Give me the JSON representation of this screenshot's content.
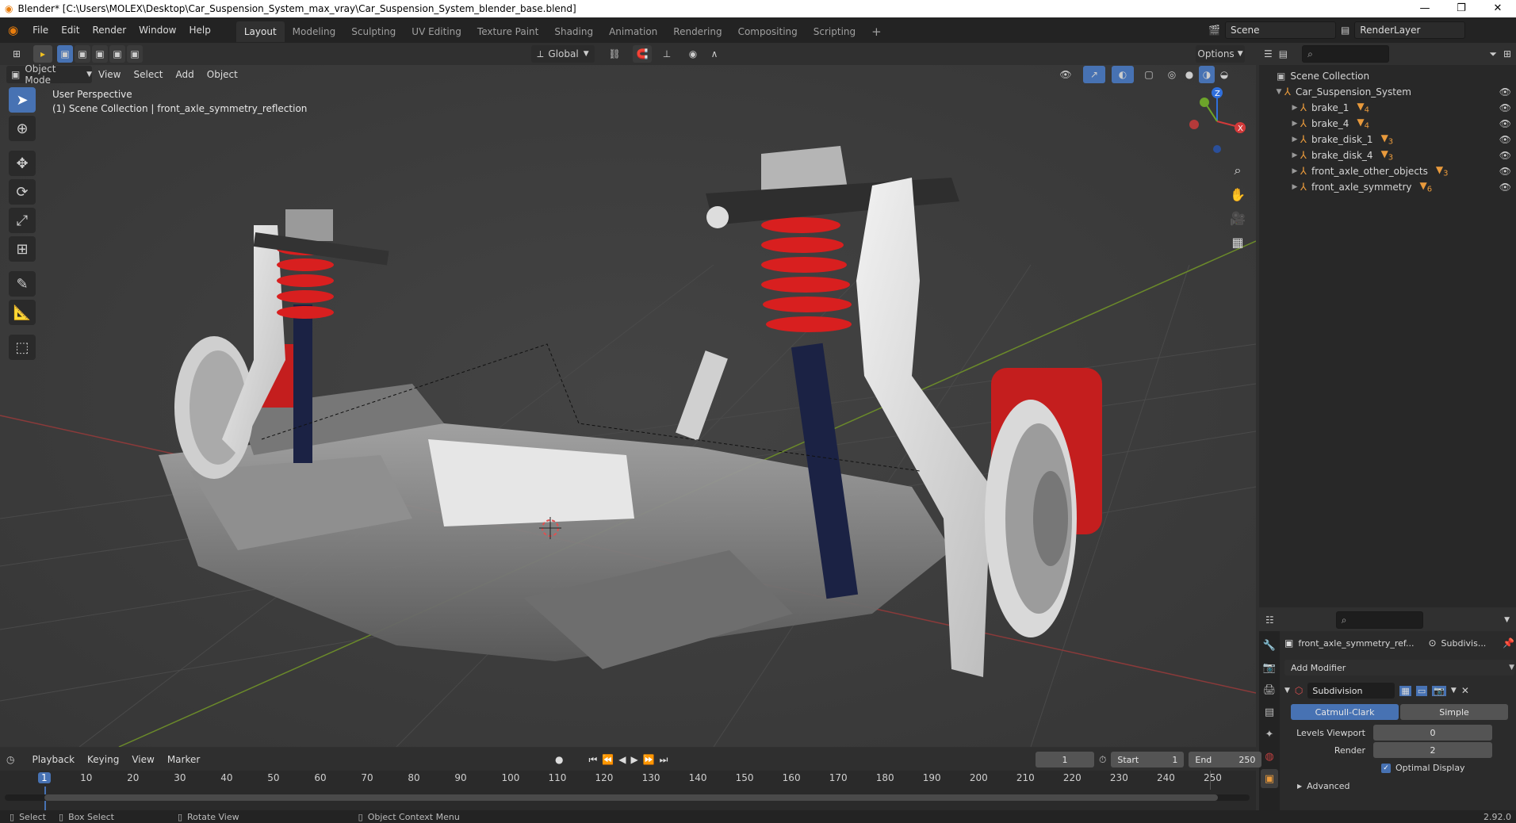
{
  "window": {
    "title": "Blender* [C:\\Users\\MOLEX\\Desktop\\Car_Suspension_System_max_vray\\Car_Suspension_System_blender_base.blend]"
  },
  "menu": [
    "File",
    "Edit",
    "Render",
    "Window",
    "Help"
  ],
  "workspaces": [
    "Layout",
    "Modeling",
    "Sculpting",
    "UV Editing",
    "Texture Paint",
    "Shading",
    "Animation",
    "Rendering",
    "Compositing",
    "Scripting"
  ],
  "active_workspace": "Layout",
  "scene_name": "Scene",
  "render_layer": "RenderLayer",
  "viewport_header": {
    "transform_orientation": "Global",
    "options_label": "Options",
    "mode": "Object Mode",
    "menus": [
      "View",
      "Select",
      "Add",
      "Object"
    ]
  },
  "viewport_overlay": {
    "line1": "User Perspective",
    "line2": "(1) Scene Collection | front_axle_symmetry_reflection"
  },
  "gizmo": {
    "z": "Z",
    "y": "Y",
    "x": "X"
  },
  "outliner": {
    "root": "Scene Collection",
    "collection": "Car_Suspension_System",
    "items": [
      {
        "name": "brake_1",
        "mods": "4"
      },
      {
        "name": "brake_4",
        "mods": "4"
      },
      {
        "name": "brake_disk_1",
        "mods": "3"
      },
      {
        "name": "brake_disk_4",
        "mods": "3"
      },
      {
        "name": "front_axle_other_objects",
        "mods": "3"
      },
      {
        "name": "front_axle_symmetry",
        "mods": "6"
      }
    ]
  },
  "properties": {
    "object_name": "front_axle_symmetry_ref...",
    "modifier_context": "Subdivis...",
    "add_modifier": "Add Modifier",
    "modifier_name": "Subdivision",
    "type_options": [
      "Catmull-Clark",
      "Simple"
    ],
    "active_type": "Catmull-Clark",
    "levels_viewport_label": "Levels Viewport",
    "levels_viewport_value": "0",
    "render_label": "Render",
    "render_value": "2",
    "optimal_display_label": "Optimal Display",
    "advanced_label": "Advanced",
    "version": "2.92.0"
  },
  "timeline": {
    "menus": [
      "Playback",
      "Keying",
      "View",
      "Marker"
    ],
    "current_frame": "1",
    "start_label": "Start",
    "start_value": "1",
    "end_label": "End",
    "end_value": "250",
    "ticks": [
      "1",
      "10",
      "20",
      "30",
      "40",
      "50",
      "60",
      "70",
      "80",
      "90",
      "100",
      "110",
      "120",
      "130",
      "140",
      "150",
      "160",
      "170",
      "180",
      "190",
      "200",
      "210",
      "220",
      "230",
      "240",
      "250"
    ]
  },
  "statusbar": {
    "select": "Select",
    "box_select": "Box Select",
    "rotate_view": "Rotate View",
    "context_menu": "Object Context Menu"
  }
}
